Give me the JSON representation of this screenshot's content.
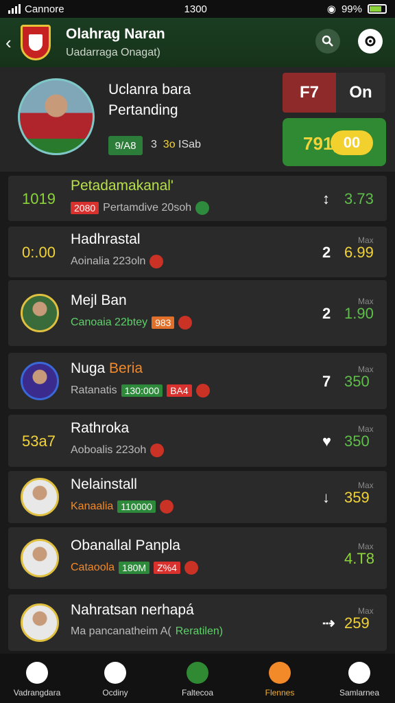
{
  "status_bar": {
    "carrier": "Cannore",
    "time": "1300",
    "battery": "99%"
  },
  "header": {
    "title": "Olahrag Naran",
    "subtitle": "Uadarraga Onagat)"
  },
  "hero": {
    "title_line1": "Uclanra bara",
    "title_line2": "Pertanding",
    "badge": "9/A8",
    "meta_a": "3",
    "meta_b": "3o",
    "meta_c": "ISab",
    "score_left": "F7",
    "score_right": "On",
    "score_value": "791,",
    "score_pill": "00"
  },
  "list": [
    {
      "left_value": "1019",
      "left_color": "#8cd43c",
      "title": "Petadamakanal'",
      "title_color": "#b7e04a",
      "tags": [
        {
          "text": "2080",
          "color": "red"
        }
      ],
      "subtitle": "Pertamdive 20soh",
      "dot": "green",
      "rank": "",
      "rank_icon": "↕",
      "max": "",
      "value": "3.73",
      "value_color": "#5fbf4a"
    },
    {
      "left_value": "0:.00",
      "left_color": "#f2d43a",
      "title": "Hadhrastal",
      "title_color": "#ffffff",
      "tags": [],
      "subtitle": "Aoinalia 223oln",
      "dot": "red",
      "rank": "2",
      "rank_icon": "",
      "max": "Max",
      "value": "6.99",
      "value_color": "#f2d43a"
    },
    {
      "avatar": "#3a6b3a",
      "title": "Mejl Ban",
      "title_color": "#ffffff",
      "tags": [
        {
          "text": "983",
          "color": "orange"
        }
      ],
      "subtitle": "Canoaia 22btey",
      "subtitle_color": "#5fd06a",
      "dot": "red",
      "rank": "2",
      "rank_icon": "",
      "max": "Max",
      "value": "1.90",
      "value_color": "#5fbf4a"
    },
    {
      "avatar": "#3a2b8c",
      "title": "Nuga",
      "title_accent": "Beria",
      "title_color": "#ffffff",
      "tags": [
        {
          "text": "130:000",
          "color": "green"
        },
        {
          "text": "BA4",
          "color": "red"
        }
      ],
      "subtitle": "Ratanatis",
      "dot": "red",
      "rank": "7",
      "rank_icon": "",
      "max": "Max",
      "value": "350",
      "value_color": "#5fbf4a"
    },
    {
      "left_value": "53a7",
      "left_color": "#f2d43a",
      "title": "Rathroka",
      "title_color": "#ffffff",
      "tags": [],
      "subtitle": "Aoboalis 223oh",
      "dot": "red",
      "rank": "",
      "rank_icon": "♥",
      "max": "Max",
      "value": "350",
      "value_color": "#5fbf4a"
    },
    {
      "avatar": "#e8e8e8",
      "title": "Nelainstall",
      "title_color": "#ffffff",
      "tags": [
        {
          "text": "110000",
          "color": "green"
        }
      ],
      "subtitle": "Kanaalia",
      "subtitle_color": "#f28a2a",
      "dot": "red",
      "rank": "",
      "rank_icon": "↓",
      "max": "Max",
      "value": "359",
      "value_color": "#f2d43a"
    },
    {
      "avatar": "#e8e8e8",
      "title": "Obanallal Panpla",
      "title_color": "#ffffff",
      "tags": [
        {
          "text": "180M",
          "color": "green"
        },
        {
          "text": "Z%4",
          "color": "red"
        }
      ],
      "subtitle": "Cataoola",
      "subtitle_color": "#f28a2a",
      "dot": "red",
      "rank": "",
      "rank_icon": "",
      "max": "Max",
      "value": "4.T8",
      "value_color": "#8cd43c"
    },
    {
      "avatar": "#e8e8e8",
      "title": "Nahratsan nerhapá",
      "title_color": "#ffffff",
      "tags": [],
      "subtitle": "Ma pancanatheim A(",
      "subtitle_accent": "Reratilen)",
      "dot": "",
      "rank": "",
      "rank_icon": "⇢",
      "max": "Max",
      "value": "259",
      "value_color": "#f2d43a"
    }
  ],
  "nav": [
    {
      "label": "Vadrangdara",
      "icon": "home-icon"
    },
    {
      "label": "Ocdiny",
      "icon": "whistle-icon"
    },
    {
      "label": "Faltecoa",
      "icon": "field-icon"
    },
    {
      "label": "Flennes",
      "icon": "ball-icon",
      "active": true
    },
    {
      "label": "Samlarnea",
      "icon": "profile-icon"
    }
  ]
}
